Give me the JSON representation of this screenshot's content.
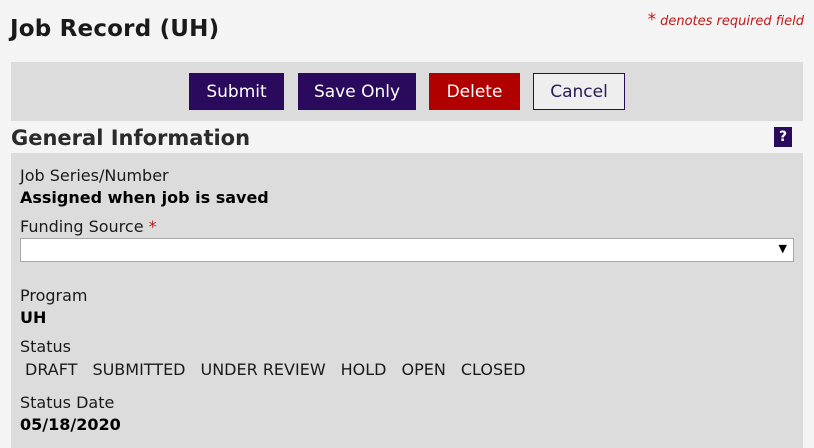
{
  "page": {
    "title": "Job Record (UH)",
    "required_note_star": "*",
    "required_note_text": "denotes required field"
  },
  "toolbar": {
    "submit_label": "Submit",
    "save_label": "Save Only",
    "delete_label": "Delete",
    "cancel_label": "Cancel"
  },
  "section": {
    "title": "General Information",
    "help_label": "?"
  },
  "fields": {
    "job_series_label": "Job Series/Number",
    "job_series_value": "Assigned when job is saved",
    "funding_source_label": "Funding Source",
    "funding_source_required": "*",
    "funding_source_value": "",
    "funding_source_caret": "▼",
    "program_label": "Program",
    "program_value": "UH",
    "status_label": "Status",
    "status_options": [
      "DRAFT",
      "SUBMITTED",
      "UNDER REVIEW",
      "HOLD",
      "OPEN",
      "CLOSED"
    ],
    "status_date_label": "Status Date",
    "status_date_value": "05/18/2020"
  },
  "colors": {
    "primary": "#2a0a5c",
    "danger": "#b00000",
    "required": "#c01818",
    "panel": "#dcdcdc",
    "page_bg": "#f4f4f4"
  }
}
